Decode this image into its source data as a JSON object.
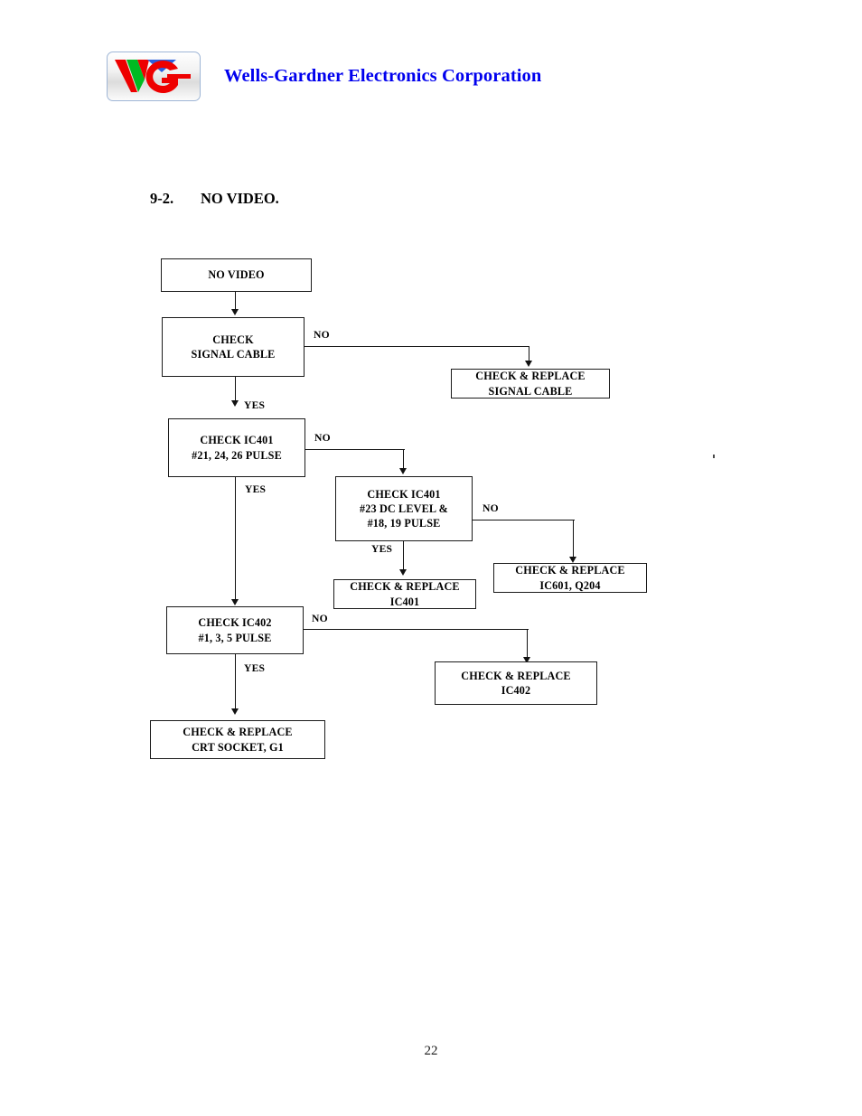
{
  "header": {
    "company_name": "Wells-Gardner Electronics Corporation",
    "logo_alt": "WG",
    "logo_colors": {
      "red": "#ee0000",
      "green": "#00bb22",
      "blue": "#2a5fe0",
      "frame": "#9fb6d6"
    },
    "company_name_color": "#0000ee"
  },
  "section": {
    "number": "9-2.",
    "title": "NO VIDEO."
  },
  "flowchart": {
    "nodes": [
      {
        "id": "start",
        "lines": [
          "NO VIDEO"
        ]
      },
      {
        "id": "check_cable",
        "lines": [
          "CHECK",
          "SIGNAL CABLE"
        ]
      },
      {
        "id": "replace_cable",
        "lines": [
          "CHECK & REPLACE",
          "SIGNAL CABLE"
        ]
      },
      {
        "id": "check_ic401_a",
        "lines": [
          "CHECK IC401",
          "#21, 24, 26 PULSE"
        ]
      },
      {
        "id": "check_ic401_b",
        "lines": [
          "CHECK IC401",
          "#23 DC LEVEL &",
          "#18, 19 PULSE"
        ]
      },
      {
        "id": "replace_ic601",
        "lines": [
          "CHECK & REPLACE",
          "IC601, Q204"
        ]
      },
      {
        "id": "replace_ic401",
        "lines": [
          "CHECK & REPLACE",
          "IC401"
        ]
      },
      {
        "id": "check_ic402",
        "lines": [
          "CHECK IC402",
          "#1, 3, 5 PULSE"
        ]
      },
      {
        "id": "replace_ic402",
        "lines": [
          "CHECK & REPLACE",
          "IC402"
        ]
      },
      {
        "id": "replace_crt",
        "lines": [
          "CHECK & REPLACE",
          "CRT SOCKET, G1"
        ]
      }
    ],
    "edge_labels": {
      "cable_no": "NO",
      "cable_yes": "YES",
      "ic401a_no": "NO",
      "ic401a_yes": "YES",
      "ic401b_no": "NO",
      "ic401b_yes": "YES",
      "ic402_no": "NO",
      "ic402_yes": "YES"
    }
  },
  "footer": {
    "page_number": "22"
  }
}
